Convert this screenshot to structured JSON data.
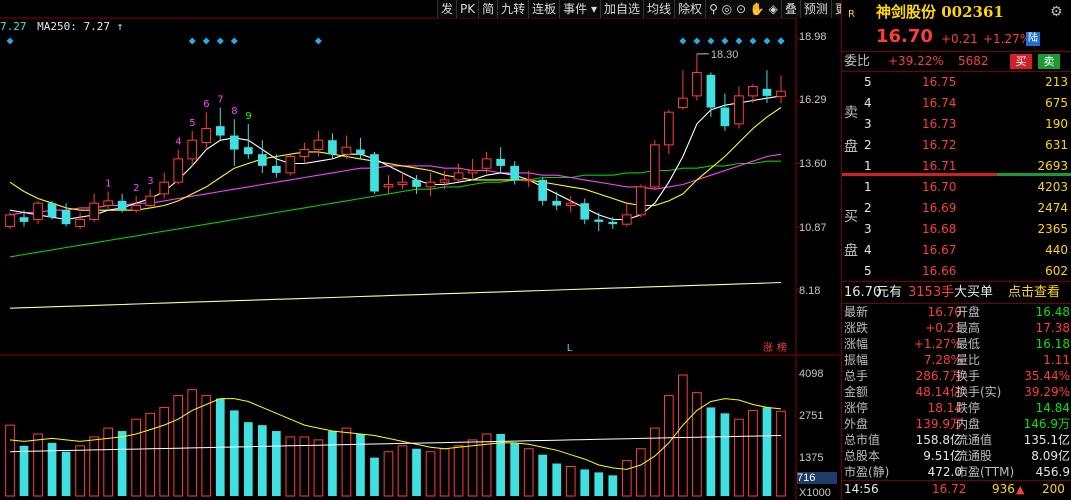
{
  "toolbar": [
    {
      "name": "tb-fa",
      "label": "发"
    },
    {
      "name": "tb-pk",
      "label": "PK"
    },
    {
      "name": "tb-jian",
      "label": "简"
    },
    {
      "name": "tb-jiuzhuan",
      "label": "九转"
    },
    {
      "name": "tb-lianban",
      "label": "连板"
    },
    {
      "name": "tb-shijian",
      "label": "事件 ▾"
    },
    {
      "name": "tb-jiazixuan",
      "label": "加自选"
    },
    {
      "name": "tb-junxian",
      "label": "均线"
    },
    {
      "name": "tb-chuquan",
      "label": "除权"
    },
    {
      "name": "tb-icons",
      "label": "⚲ ◎ ⊙ ✋ ◈"
    },
    {
      "name": "tb-die",
      "label": "叠"
    },
    {
      "name": "tb-yuce",
      "label": "预测"
    },
    {
      "name": "tb-gengduo",
      "label": "更多"
    },
    {
      "name": "tb-exit",
      "label": "⇥ ▾"
    }
  ],
  "ma_legend": {
    "left_value": "7.27",
    "ma250": "MA250: 7.27 ↑"
  },
  "price_axis": [
    "18.98",
    "16.29",
    "13.60",
    "10.87",
    "8.18"
  ],
  "volume_axis": [
    "4098",
    "2751",
    "1375",
    "716",
    "X1000"
  ],
  "chart_data": {
    "type": "candlestick",
    "price_ylim": [
      8.18,
      18.98
    ],
    "high_marker": "18.30",
    "candles": [
      [
        10.9,
        11.4,
        10.8,
        11.5
      ],
      [
        11.3,
        11.1,
        10.9,
        11.6
      ],
      [
        11.2,
        11.9,
        11.0,
        12.0
      ],
      [
        11.9,
        11.3,
        11.2,
        12.0
      ],
      [
        11.6,
        11.0,
        10.9,
        11.9
      ],
      [
        10.9,
        11.2,
        10.8,
        11.5
      ],
      [
        11.2,
        11.9,
        11.1,
        12.3
      ],
      [
        11.8,
        12.0,
        11.6,
        12.4
      ],
      [
        12.0,
        11.6,
        11.5,
        12.3
      ],
      [
        11.6,
        11.8,
        11.5,
        12.2
      ],
      [
        11.8,
        12.2,
        11.7,
        12.5
      ],
      [
        12.3,
        12.8,
        12.1,
        13.2
      ],
      [
        12.8,
        13.8,
        12.7,
        14.2
      ],
      [
        13.8,
        14.6,
        13.5,
        15.0
      ],
      [
        14.5,
        15.1,
        14.2,
        15.8
      ],
      [
        15.2,
        14.8,
        14.6,
        16.0
      ],
      [
        14.8,
        14.2,
        13.5,
        15.5
      ],
      [
        14.3,
        14.0,
        13.8,
        15.3
      ],
      [
        14.0,
        13.5,
        13.2,
        14.6
      ],
      [
        13.5,
        13.2,
        13.0,
        14.0
      ],
      [
        13.2,
        13.9,
        13.1,
        14.0
      ],
      [
        13.9,
        14.2,
        13.6,
        14.5
      ],
      [
        14.2,
        14.6,
        13.9,
        15.0
      ],
      [
        14.6,
        14.0,
        13.8,
        14.9
      ],
      [
        14.0,
        14.3,
        13.8,
        14.8
      ],
      [
        14.2,
        14.0,
        13.8,
        14.7
      ],
      [
        14.0,
        12.4,
        12.3,
        14.1
      ],
      [
        12.6,
        12.7,
        12.3,
        13.1
      ],
      [
        12.7,
        12.8,
        12.5,
        13.2
      ],
      [
        12.9,
        12.6,
        12.3,
        13.1
      ],
      [
        12.6,
        12.8,
        12.2,
        13.2
      ],
      [
        12.8,
        12.9,
        12.5,
        13.3
      ],
      [
        12.9,
        13.2,
        12.8,
        13.6
      ],
      [
        13.2,
        13.3,
        12.9,
        13.8
      ],
      [
        13.4,
        13.8,
        13.2,
        14.1
      ],
      [
        13.8,
        13.5,
        13.2,
        14.3
      ],
      [
        13.5,
        12.9,
        12.7,
        13.7
      ],
      [
        12.9,
        12.9,
        12.6,
        13.3
      ],
      [
        12.9,
        12.0,
        11.8,
        13.0
      ],
      [
        12.0,
        11.8,
        11.6,
        12.4
      ],
      [
        11.8,
        11.9,
        11.5,
        12.2
      ],
      [
        11.9,
        11.2,
        11.0,
        12.1
      ],
      [
        11.2,
        11.1,
        10.7,
        11.5
      ],
      [
        11.1,
        11.0,
        10.8,
        11.3
      ],
      [
        11.0,
        11.4,
        10.9,
        11.9
      ],
      [
        11.4,
        12.6,
        11.3,
        12.7
      ],
      [
        12.6,
        14.4,
        12.5,
        14.6
      ],
      [
        14.4,
        15.8,
        14.0,
        15.9
      ],
      [
        16.0,
        16.4,
        15.9,
        17.6
      ],
      [
        16.5,
        17.5,
        16.3,
        18.3
      ],
      [
        17.4,
        16.0,
        15.6,
        17.5
      ],
      [
        16.0,
        15.2,
        15.0,
        16.6
      ],
      [
        15.3,
        16.5,
        15.1,
        16.9
      ],
      [
        16.5,
        16.9,
        16.2,
        17.0
      ],
      [
        16.8,
        16.5,
        16.2,
        17.6
      ],
      [
        16.48,
        16.7,
        16.18,
        17.38
      ]
    ],
    "ma5": [
      11.6,
      11.5,
      11.4,
      11.3,
      11.2,
      11.3,
      11.4,
      11.6,
      11.7,
      11.9,
      12.1,
      12.4,
      12.9,
      13.5,
      14.2,
      14.6,
      14.7,
      14.6,
      14.2,
      13.8,
      13.6,
      13.6,
      13.7,
      13.8,
      14.0,
      14.0,
      13.8,
      13.5,
      13.2,
      12.9,
      12.7,
      12.7,
      12.8,
      12.9,
      13.1,
      13.2,
      13.1,
      12.9,
      12.6,
      12.3,
      12.0,
      11.7,
      11.4,
      11.2,
      11.2,
      11.4,
      11.9,
      12.8,
      13.9,
      15.3,
      15.9,
      16.1,
      16.2,
      16.3,
      16.4,
      16.5
    ],
    "ma10": [
      12.8,
      12.4,
      12.1,
      11.9,
      11.7,
      11.6,
      11.6,
      11.6,
      11.6,
      11.6,
      11.7,
      11.8,
      12.0,
      12.3,
      12.6,
      13.0,
      13.4,
      13.6,
      13.8,
      13.9,
      14.0,
      14.1,
      14.1,
      14.0,
      13.9,
      13.8,
      13.7,
      13.6,
      13.5,
      13.4,
      13.3,
      13.1,
      13.0,
      12.9,
      12.9,
      12.9,
      12.9,
      12.9,
      12.8,
      12.7,
      12.6,
      12.5,
      12.3,
      12.1,
      11.9,
      11.8,
      11.8,
      12.0,
      12.3,
      12.9,
      13.4,
      13.9,
      14.5,
      15.1,
      15.6,
      16.0
    ],
    "ma20": [
      11.4,
      11.5,
      11.5,
      11.6,
      11.6,
      11.7,
      11.7,
      11.8,
      11.8,
      11.9,
      11.9,
      12.0,
      12.1,
      12.2,
      12.3,
      12.4,
      12.5,
      12.6,
      12.7,
      12.8,
      12.9,
      13.0,
      13.1,
      13.2,
      13.3,
      13.4,
      13.4,
      13.5,
      13.5,
      13.5,
      13.5,
      13.4,
      13.4,
      13.3,
      13.3,
      13.2,
      13.2,
      13.2,
      13.1,
      13.1,
      13.0,
      12.9,
      12.8,
      12.7,
      12.6,
      12.6,
      12.5,
      12.6,
      12.7,
      12.9,
      13.1,
      13.3,
      13.5,
      13.7,
      13.9,
      14.0
    ],
    "ma60": [
      9.6,
      9.7,
      9.8,
      9.9,
      10.0,
      10.1,
      10.2,
      10.3,
      10.4,
      10.5,
      10.6,
      10.7,
      10.8,
      10.9,
      11.0,
      11.1,
      11.2,
      11.3,
      11.4,
      11.5,
      11.6,
      11.7,
      11.8,
      11.9,
      12.0,
      12.1,
      12.2,
      12.3,
      12.4,
      12.5,
      12.5,
      12.6,
      12.6,
      12.7,
      12.8,
      12.8,
      12.9,
      12.9,
      13.0,
      13.0,
      13.0,
      13.1,
      13.1,
      13.1,
      13.2,
      13.2,
      13.3,
      13.3,
      13.4,
      13.4,
      13.5,
      13.5,
      13.6,
      13.6,
      13.7,
      13.7
    ],
    "ma250": [
      7.4,
      7.42,
      7.44,
      7.46,
      7.48,
      7.5,
      7.52,
      7.54,
      7.56,
      7.58,
      7.6,
      7.62,
      7.64,
      7.66,
      7.68,
      7.7,
      7.72,
      7.74,
      7.76,
      7.78,
      7.8,
      7.82,
      7.84,
      7.86,
      7.88,
      7.9,
      7.92,
      7.94,
      7.96,
      7.98,
      8.0,
      8.02,
      8.04,
      8.06,
      8.08,
      8.1,
      8.12,
      8.14,
      8.16,
      8.18,
      8.2,
      8.22,
      8.24,
      8.26,
      8.28,
      8.3,
      8.32,
      8.34,
      8.36,
      8.38,
      8.4,
      8.42,
      8.44,
      8.46,
      8.48,
      8.5
    ],
    "volume": [
      2400,
      1700,
      2100,
      1800,
      1500,
      1700,
      2000,
      2300,
      2200,
      2600,
      2800,
      3000,
      3400,
      3600,
      3400,
      3300,
      2900,
      2500,
      2400,
      2200,
      2000,
      2000,
      1900,
      2200,
      2300,
      2100,
      1300,
      1500,
      1700,
      1600,
      1500,
      1600,
      1700,
      1900,
      2100,
      2100,
      1800,
      1600,
      1400,
      1100,
      1000,
      900,
      800,
      700,
      1200,
      1600,
      2300,
      3400,
      4098,
      3500,
      3000,
      2800,
      2600,
      2900,
      3000,
      2870
    ],
    "vol_ma5": [
      1900,
      1850,
      1900,
      1950,
      1900,
      1850,
      1900,
      1950,
      2000,
      2100,
      2250,
      2400,
      2600,
      2900,
      3100,
      3300,
      3300,
      3200,
      3000,
      2800,
      2600,
      2400,
      2300,
      2200,
      2150,
      2100,
      2050,
      1950,
      1850,
      1750,
      1650,
      1600,
      1650,
      1700,
      1750,
      1800,
      1800,
      1750,
      1650,
      1550,
      1400,
      1250,
      1050,
      950,
      900,
      1050,
      1350,
      1800,
      2400,
      2900,
      3200,
      3300,
      3250,
      3100,
      3000,
      2950
    ],
    "vol_ma_long": [
      1500,
      1510,
      1520,
      1530,
      1540,
      1550,
      1560,
      1570,
      1580,
      1590,
      1600,
      1610,
      1620,
      1630,
      1640,
      1650,
      1660,
      1670,
      1680,
      1690,
      1700,
      1710,
      1720,
      1730,
      1740,
      1750,
      1760,
      1770,
      1780,
      1790,
      1800,
      1810,
      1820,
      1830,
      1840,
      1850,
      1860,
      1870,
      1880,
      1890,
      1900,
      1910,
      1920,
      1930,
      1940,
      1950,
      1960,
      1970,
      1980,
      1990,
      2000,
      2010,
      2020,
      2030,
      2040,
      2050
    ],
    "vol_ylim": [
      0,
      4098
    ],
    "up_color": "#ff3b3b",
    "down_color": "#40e0e0",
    "ma_colors": {
      "ma5": "#ffffff",
      "ma10": "#ffff00",
      "ma20": "#ff40ff",
      "ma60": "#00d000",
      "ma250": "#ffff99"
    },
    "td_marks": [
      {
        "i": 7,
        "t": "1",
        "c": "#ff40ff"
      },
      {
        "i": 9,
        "t": "2",
        "c": "#ff40ff"
      },
      {
        "i": 10,
        "t": "3",
        "c": "#ff40ff"
      },
      {
        "i": 12,
        "t": "4",
        "c": "#ff40ff"
      },
      {
        "i": 13,
        "t": "5",
        "c": "#ff40ff"
      },
      {
        "i": 14,
        "t": "6",
        "c": "#ff40ff"
      },
      {
        "i": 15,
        "t": "7",
        "c": "#ff40ff"
      },
      {
        "i": 16,
        "t": "8",
        "c": "#ff40ff"
      },
      {
        "i": 17,
        "t": "9",
        "c": "#00ff00"
      }
    ],
    "diamond_idx": [
      0,
      13,
      14,
      15,
      16,
      22,
      48,
      49,
      50,
      51,
      52,
      53,
      54,
      55,
      58,
      59,
      61,
      62
    ],
    "bottom_marks": [
      {
        "i": 40,
        "t": "L",
        "c": "#40e0e0"
      },
      {
        "i": 54,
        "t": "涨",
        "c": "#ff3b3b"
      },
      {
        "i": 56,
        "t": "榜",
        "c": "#ff3b3b"
      }
    ]
  },
  "quote": {
    "r_badge": "R",
    "title": "神剑股份 002361",
    "price": "16.70",
    "change": "+0.21",
    "pct": "+1.27%",
    "lu_badge": "陆",
    "weibi_label": "委比",
    "weibi_value": "+39.22%",
    "weibi_diff": "5682",
    "buy_label": "买",
    "sell_label": "卖",
    "ask_group": "卖盘",
    "bid_group": "买盘",
    "asks": [
      {
        "lvl": "5",
        "price": "16.75",
        "vol": "213"
      },
      {
        "lvl": "4",
        "price": "16.74",
        "vol": "675"
      },
      {
        "lvl": "3",
        "price": "16.73",
        "vol": "190"
      },
      {
        "lvl": "2",
        "price": "16.72",
        "vol": "631"
      },
      {
        "lvl": "1",
        "price": "16.71",
        "vol": "2693"
      }
    ],
    "bids": [
      {
        "lvl": "1",
        "price": "16.70",
        "vol": "4203"
      },
      {
        "lvl": "2",
        "price": "16.69",
        "vol": "2474"
      },
      {
        "lvl": "3",
        "price": "16.68",
        "vol": "2365"
      },
      {
        "lvl": "4",
        "price": "16.67",
        "vol": "440"
      },
      {
        "lvl": "5",
        "price": "16.66",
        "vol": "602"
      }
    ],
    "bigorder": {
      "price": "16.70",
      "yuan": "元有",
      "qty": "3153手",
      "text": "大买单",
      "link": "点击查看"
    },
    "stats": [
      {
        "l1": "最新",
        "v1": "16.70",
        "c1": "red",
        "l2": "开盘",
        "v2": "16.48",
        "c2": "green"
      },
      {
        "l1": "涨跌",
        "v1": "+0.21",
        "c1": "red",
        "l2": "最高",
        "v2": "17.38",
        "c2": "red"
      },
      {
        "l1": "涨幅",
        "v1": "+1.27%",
        "c1": "red",
        "l2": "最低",
        "v2": "16.18",
        "c2": "green"
      },
      {
        "l1": "振幅",
        "v1": "7.28%",
        "c1": "red",
        "l2": "量比",
        "v2": "1.11",
        "c2": "red"
      },
      {
        "l1": "总手",
        "v1": "286.7万",
        "c1": "red",
        "l2": "换手",
        "v2": "35.44%",
        "c2": "red"
      },
      {
        "l1": "金额",
        "v1": "48.14亿",
        "c1": "red",
        "l2": "换手(实)",
        "v2": "39.29%",
        "c2": "red"
      },
      {
        "l1": "涨停",
        "v1": "18.14",
        "c1": "red",
        "l2": "跌停",
        "v2": "14.84",
        "c2": "green"
      },
      {
        "l1": "外盘",
        "v1": "139.9万",
        "c1": "red",
        "l2": "内盘",
        "v2": "146.9万",
        "c2": "green"
      },
      {
        "l1": "总市值",
        "v1": "158.8亿",
        "c1": "wht",
        "l2": "流通值",
        "v2": "135.1亿",
        "c2": "wht"
      },
      {
        "l1": "总股本",
        "v1": "9.51亿",
        "c1": "wht",
        "l2": "流通股",
        "v2": "8.09亿",
        "c2": "wht"
      },
      {
        "l1": "市盈(静)",
        "v1": "472.0",
        "c1": "wht",
        "l2": "市盈(TTM)",
        "v2": "456.9",
        "c2": "wht"
      }
    ],
    "tick": {
      "time": "14:56",
      "price": "16.72",
      "vol": "936",
      "vol2": "200"
    }
  }
}
